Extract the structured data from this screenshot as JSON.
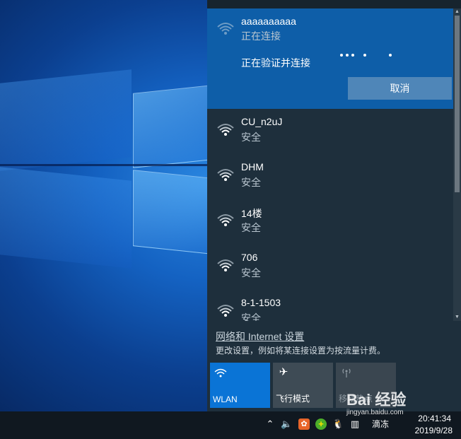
{
  "connecting_network": {
    "name": "aaaaaaaaaa",
    "status": "正在连接",
    "detail": "正在验证并连接",
    "cancel_label": "取消"
  },
  "networks": [
    {
      "name": "CU_n2uJ",
      "status": "安全"
    },
    {
      "name": "DHM",
      "status": "安全"
    },
    {
      "name": "14楼",
      "status": "安全"
    },
    {
      "name": "706",
      "status": "安全"
    },
    {
      "name": "8-1-1503",
      "status": "安全"
    }
  ],
  "settings": {
    "link": "网络和 Internet 设置",
    "description": "更改设置，例如将某连接设置为按流量计费。"
  },
  "quick_actions": [
    {
      "label": "WLAN",
      "icon": "wifi-icon",
      "state": "active"
    },
    {
      "label": "飞行模式",
      "icon": "airplane-icon",
      "state": "off"
    },
    {
      "label": "移动热点",
      "icon": "hotspot-icon",
      "state": "disabled"
    }
  ],
  "taskbar": {
    "time": "20:41:34",
    "date": "2019/9/28",
    "tray_text": "滴冻"
  },
  "watermark": {
    "text": "Bai 经验",
    "sub": "jingyan.baidu.com"
  },
  "colors": {
    "flyout_bg": "#1e2f3c",
    "connecting_bg": "#0e5ea8",
    "accent": "#0a74d6"
  }
}
